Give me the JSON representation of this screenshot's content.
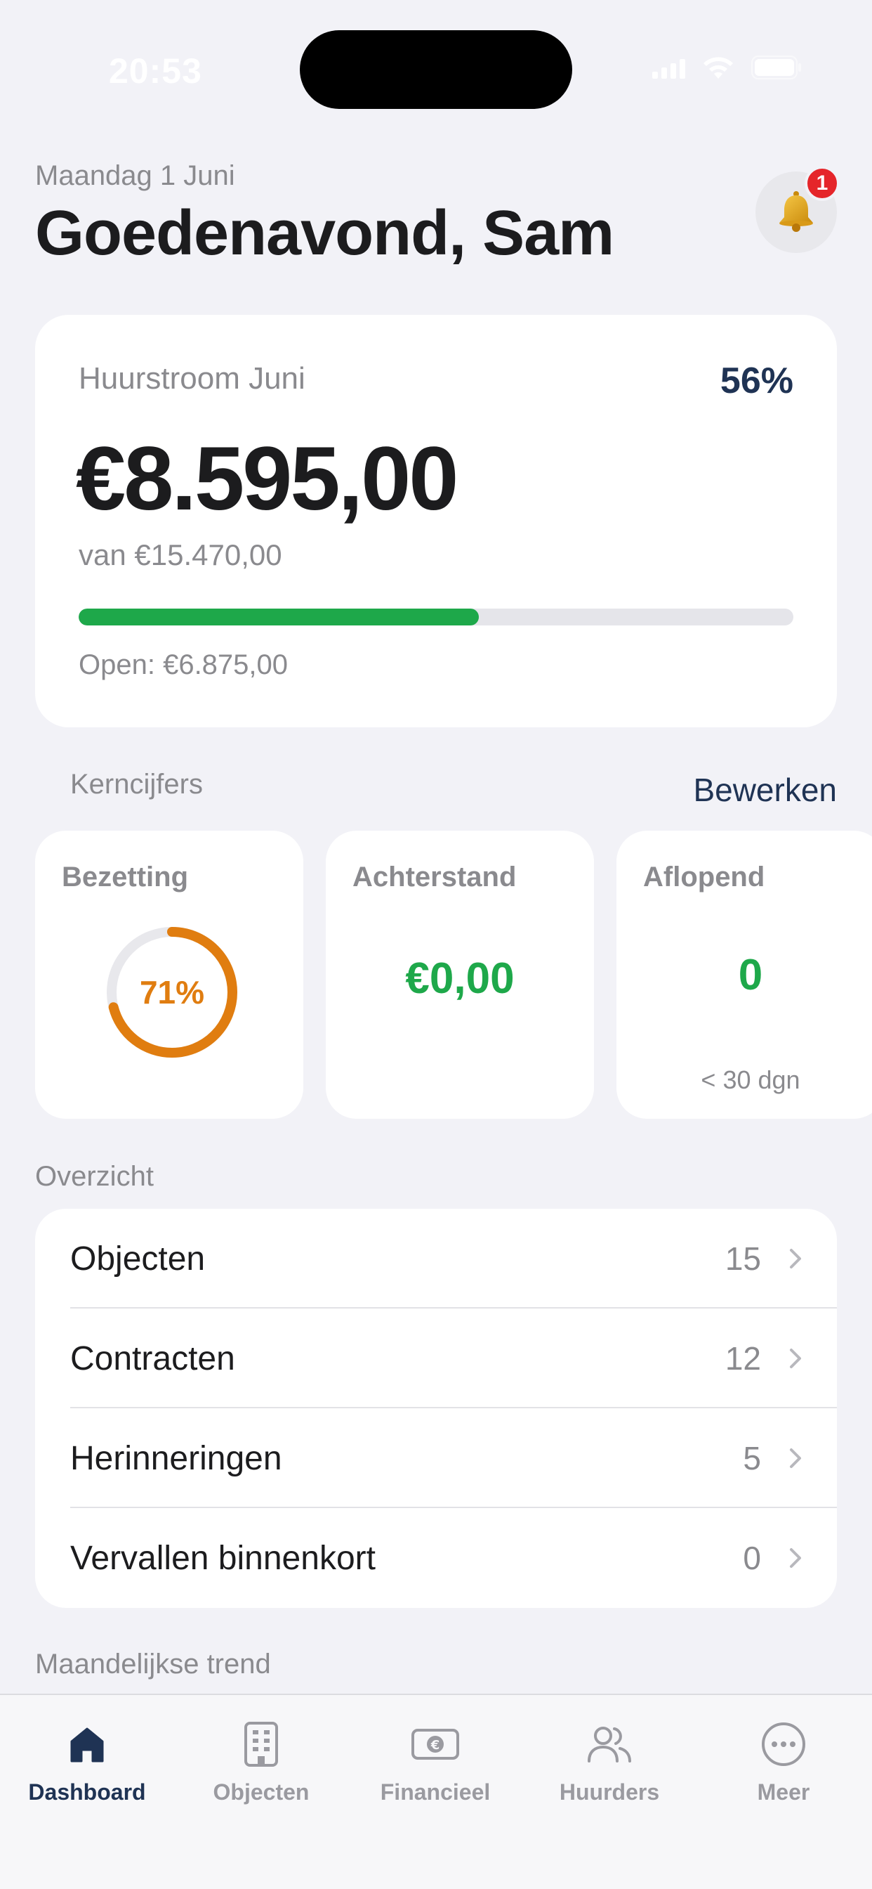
{
  "status_bar": {
    "time": "20:53"
  },
  "header": {
    "date": "Maandag 1 Juni",
    "greeting": "Goedenavond, Sam",
    "notification_count": "1"
  },
  "rent_card": {
    "title": "Huurstroom Juni",
    "percent_label": "56%",
    "progress": 0.56,
    "amount": "€8.595,00",
    "of_total": "van €15.470,00",
    "open": "Open: €6.875,00",
    "progress_color": "#1ea84a"
  },
  "key_figures": {
    "label": "Kerncijfers",
    "edit_label": "Bewerken",
    "cards": [
      {
        "title": "Bezetting",
        "value": "71%",
        "ring_fraction": 0.71,
        "color": "#e07d10"
      },
      {
        "title": "Achterstand",
        "value": "€0,00",
        "color": "#1ea84a"
      },
      {
        "title": "Aflopend",
        "value": "0",
        "sub": "< 30 dgn",
        "color": "#1ea84a"
      }
    ]
  },
  "overview": {
    "label": "Overzicht",
    "items": [
      {
        "label": "Objecten",
        "count": "15"
      },
      {
        "label": "Contracten",
        "count": "12"
      },
      {
        "label": "Herinneringen",
        "count": "5"
      },
      {
        "label": "Vervallen binnenkort",
        "count": "0"
      }
    ]
  },
  "trend": {
    "label": "Maandelijkse trend"
  },
  "tab_bar": {
    "tabs": [
      {
        "label": "Dashboard",
        "icon": "house-icon",
        "active": true
      },
      {
        "label": "Objecten",
        "icon": "building-icon",
        "active": false
      },
      {
        "label": "Financieel",
        "icon": "euro-note-icon",
        "active": false
      },
      {
        "label": "Huurders",
        "icon": "people-icon",
        "active": false
      },
      {
        "label": "Meer",
        "icon": "more-icon",
        "active": false
      }
    ]
  },
  "colors": {
    "accent": "#1f3354",
    "green": "#1ea84a",
    "orange": "#e07d10",
    "badge": "#e5252a"
  }
}
